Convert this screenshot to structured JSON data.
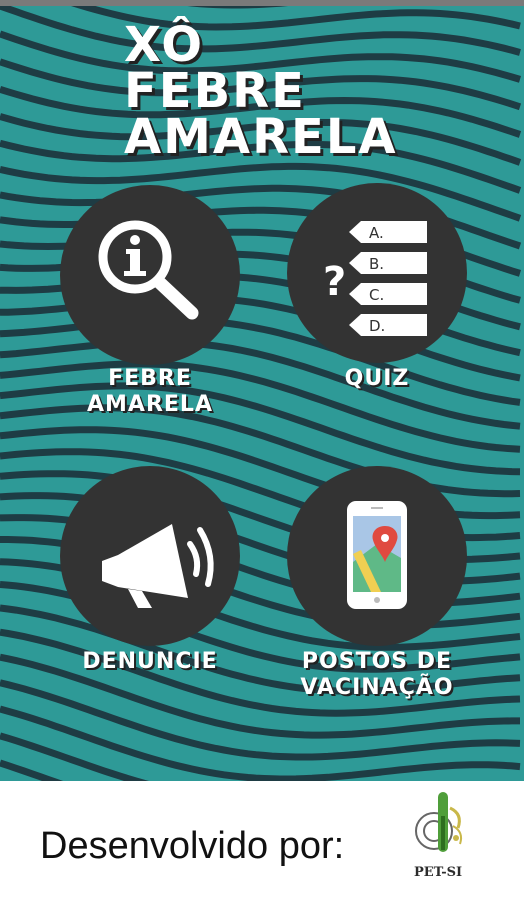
{
  "app": {
    "title_lines": [
      "XÔ",
      "FEBRE",
      "AMARELA"
    ]
  },
  "menu": {
    "febre": {
      "label_lines": [
        "FEBRE",
        "AMARELA"
      ],
      "icon": "info-magnifier-icon"
    },
    "quiz": {
      "label": "QUIZ",
      "icon": "quiz-icon",
      "question_mark": "?",
      "options": [
        "A.",
        "B.",
        "C.",
        "D."
      ]
    },
    "denuncie": {
      "label": "DENUNCIE",
      "icon": "megaphone-icon"
    },
    "postos": {
      "label_lines": [
        "POSTOS DE",
        "VACINAÇÃO"
      ],
      "icon": "map-phone-icon"
    }
  },
  "footer": {
    "developed_by": "Desenvolvido por:",
    "logo_text": "PET-SI"
  },
  "colors": {
    "background": "#2e9a97",
    "waves": "#1e3c44",
    "circle": "#333333",
    "text": "#ffffff"
  }
}
